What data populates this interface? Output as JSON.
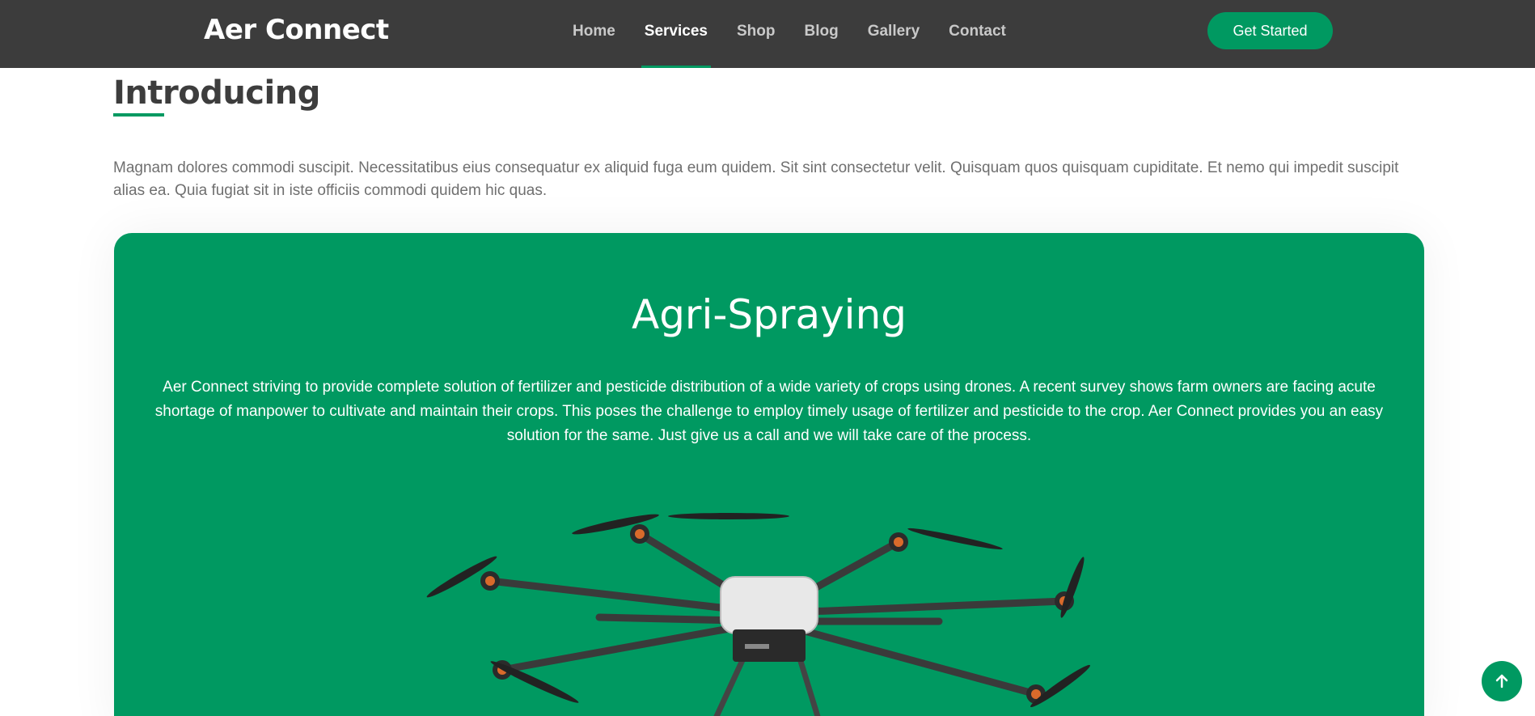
{
  "header": {
    "logo": "Aer Connect",
    "nav": [
      {
        "label": "Home",
        "active": false
      },
      {
        "label": "Services",
        "active": true
      },
      {
        "label": "Shop",
        "active": false
      },
      {
        "label": "Blog",
        "active": false
      },
      {
        "label": "Gallery",
        "active": false
      },
      {
        "label": "Contact",
        "active": false
      }
    ],
    "cta_label": "Get Started"
  },
  "section": {
    "title": "Introducing",
    "intro": "Magnam dolores commodi suscipit. Necessitatibus eius consequatur ex aliquid fuga eum quidem. Sit sint consectetur velit. Quisquam quos quisquam cupiditate. Et nemo qui impedit suscipit alias ea. Quia fugiat sit in iste officiis commodi quidem hic quas."
  },
  "card": {
    "title": "Agri-Spraying",
    "text": "Aer Connect striving to provide complete solution of fertilizer and pesticide distribution of a wide variety of crops using drones. A recent survey shows farm owners are facing acute shortage of manpower to cultivate and maintain their crops. This poses the challenge to employ timely usage of fertilizer and pesticide to the crop. Aer Connect provides you an easy solution for the same. Just give us a call and we will take care of the process.",
    "image": "agricultural-spraying-drone"
  },
  "colors": {
    "accent": "#009961",
    "header_bg": "#3c3c3c"
  },
  "icons": {
    "back_to_top": "arrow-up-icon"
  }
}
